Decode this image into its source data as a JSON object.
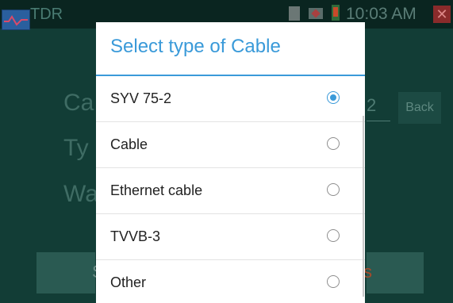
{
  "statusbar": {
    "app_title": "TDR",
    "clock": "10:03 AM",
    "close_glyph": "✕"
  },
  "background": {
    "labels": [
      "Ca",
      "Ty",
      "Wa"
    ],
    "value": "2",
    "back_label": "Back",
    "button_left_label": "S",
    "button_right_label": "s"
  },
  "dialog": {
    "title": "Select type of Cable",
    "options": [
      {
        "label": "SYV 75-2",
        "selected": true
      },
      {
        "label": "Cable",
        "selected": false
      },
      {
        "label": "Ethernet cable",
        "selected": false
      },
      {
        "label": "TVVB-3",
        "selected": false
      },
      {
        "label": "Other",
        "selected": false
      }
    ]
  },
  "colors": {
    "accent": "#3a9ad9",
    "background": "#123d36"
  }
}
